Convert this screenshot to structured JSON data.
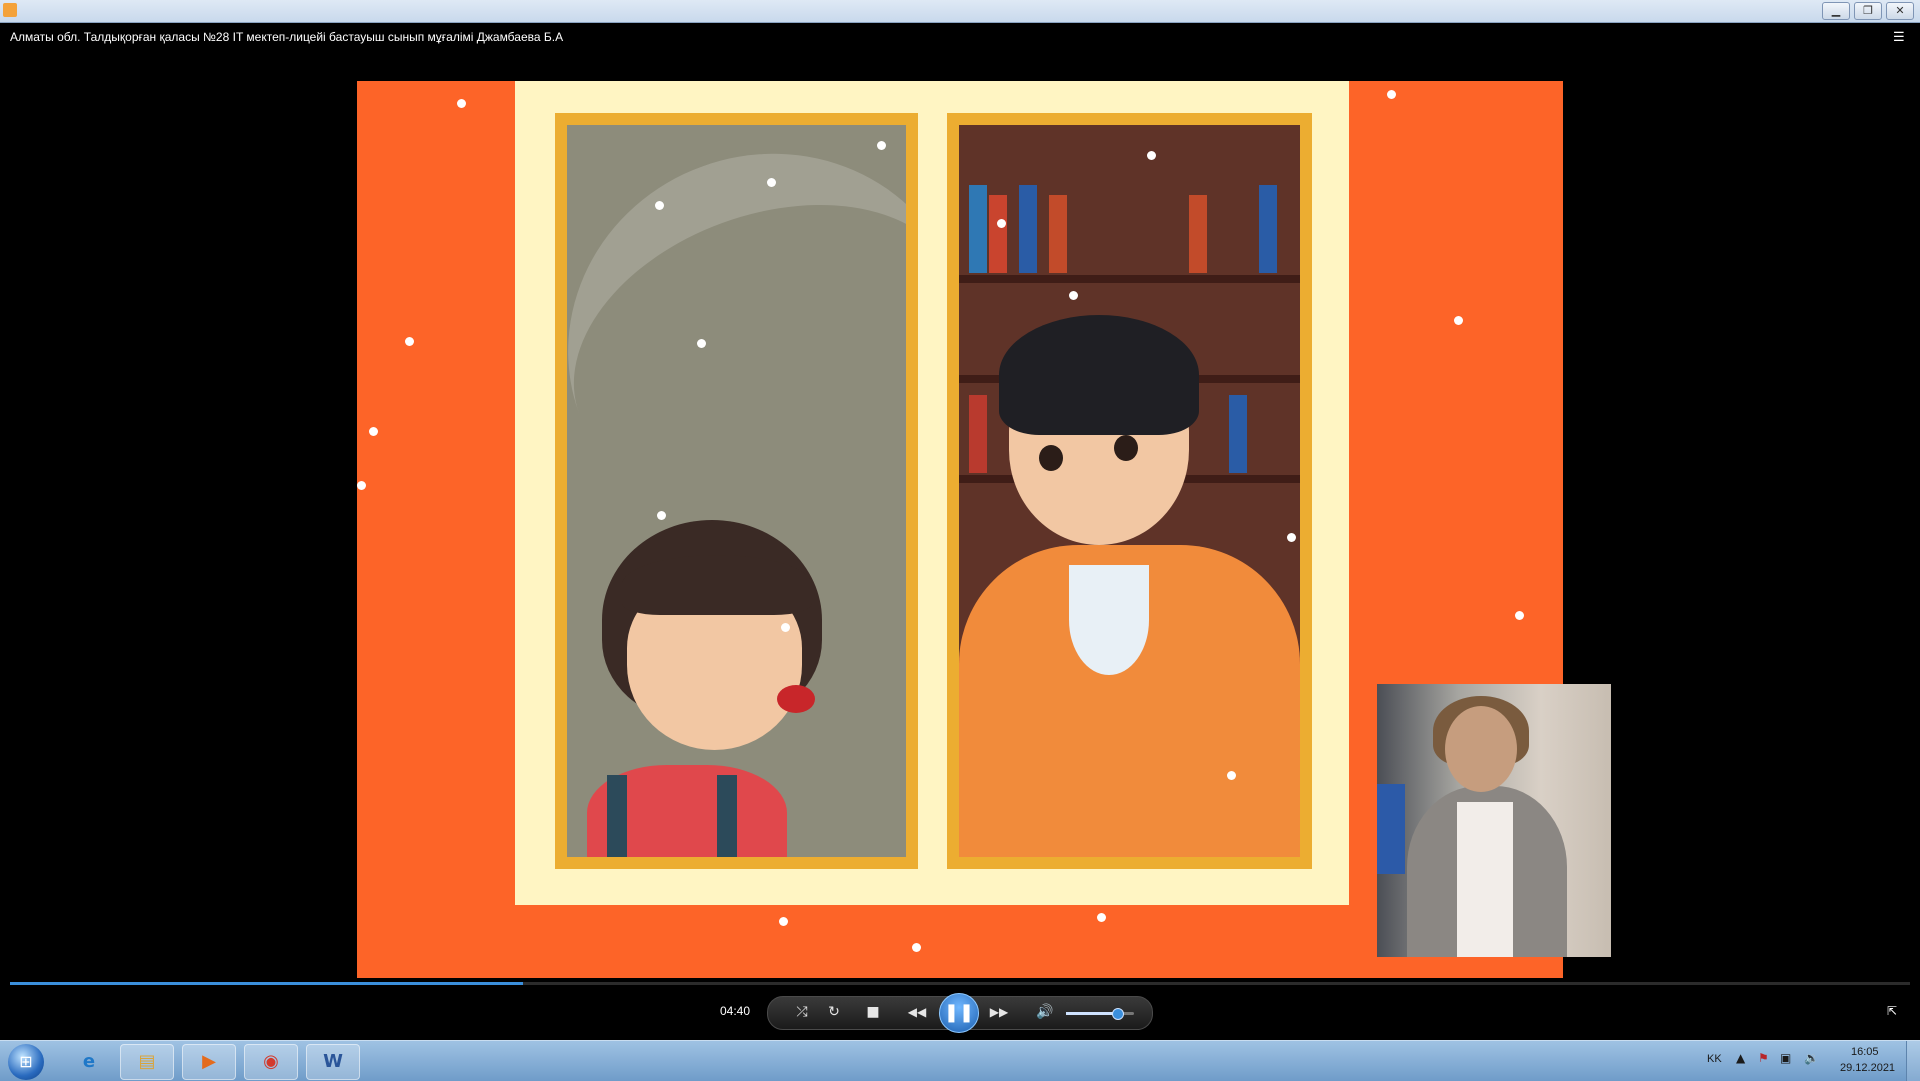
{
  "window": {
    "title_icon": "media-player-icon",
    "minimize_glyph": "▁",
    "maximize_glyph": "❐",
    "close_glyph": "✕"
  },
  "media": {
    "title": "Алматы обл. Талдықорған қаласы №28 IT мектеп-лицейі бастауыш сынып мұғалімі Джамбаева Б.А"
  },
  "playback": {
    "elapsed": "04:40",
    "progress_fraction": 0.27,
    "volume_fraction": 0.75,
    "shuffle_glyph": "⤮",
    "repeat_glyph": "↻",
    "stop_glyph": "■",
    "prev_glyph": "◀◀",
    "pause_glyph": "❚❚",
    "next_glyph": "▶▶",
    "mute_glyph": "🔊",
    "switch_glyph": "⇱",
    "playlist_glyph": "☰"
  },
  "taskbar": {
    "start_glyph": "⊞",
    "apps": [
      {
        "name": "internet-explorer-icon",
        "glyph": "e"
      },
      {
        "name": "file-explorer-icon",
        "glyph": "▤"
      },
      {
        "name": "media-player-icon",
        "glyph": "▶"
      },
      {
        "name": "chrome-icon",
        "glyph": "◉"
      },
      {
        "name": "word-icon",
        "glyph": "W"
      }
    ],
    "language": "KK",
    "tray": {
      "expand_glyph": "▲",
      "flag_glyph": "⚑",
      "network_glyph": "▣",
      "volume_glyph": "🔉"
    },
    "time": "16:05",
    "date": "29.12.2021"
  },
  "colors": {
    "video_background": "#fd6428",
    "accent": "#3b8fdc"
  }
}
